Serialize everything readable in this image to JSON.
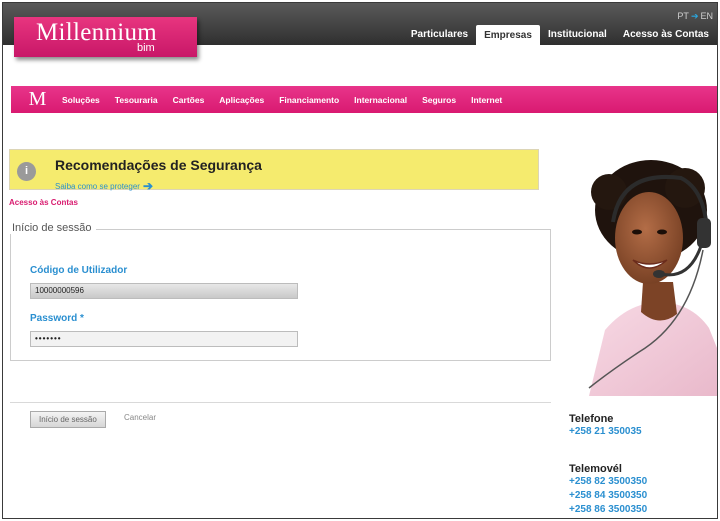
{
  "header": {
    "logo": {
      "brand": "Millennium",
      "sub": "bim"
    },
    "lang": {
      "pt": "PT",
      "en": "EN"
    },
    "tabs": [
      {
        "label": "Particulares",
        "active": false
      },
      {
        "label": "Empresas",
        "active": true
      },
      {
        "label": "Institucional",
        "active": false
      },
      {
        "label": "Acesso às Contas",
        "active": false
      }
    ]
  },
  "nav": {
    "logo_letter": "M",
    "items": [
      "Soluções",
      "Tesouraria",
      "Cartões",
      "Aplicações",
      "Financiamento",
      "Internacional",
      "Seguros",
      "Internet"
    ]
  },
  "banner": {
    "icon": "info-icon",
    "title": "Recomendações de Segurança",
    "link": "Saiba como se proteger"
  },
  "breadcrumb": "Acesso às Contas",
  "login": {
    "legend": "Início de sessão",
    "user_label": "Código de Utilizador",
    "user_value": "10000000596",
    "password_label": "Password *",
    "password_value": "•••••••",
    "submit_label": "Início de sessão",
    "cancel_label": "Cancelar"
  },
  "contact": {
    "telefone_label": "Telefone",
    "telefone": "+258 21 350035",
    "telemovel_label": "Telemovél",
    "telemoveis": [
      "+258 82 3500350",
      "+258 84 3500350",
      "+258 86 3500350"
    ]
  },
  "colors": {
    "brand_pink": "#d91a71",
    "link_blue": "#2a8fd0",
    "banner_yellow": "#f5eb6e"
  }
}
